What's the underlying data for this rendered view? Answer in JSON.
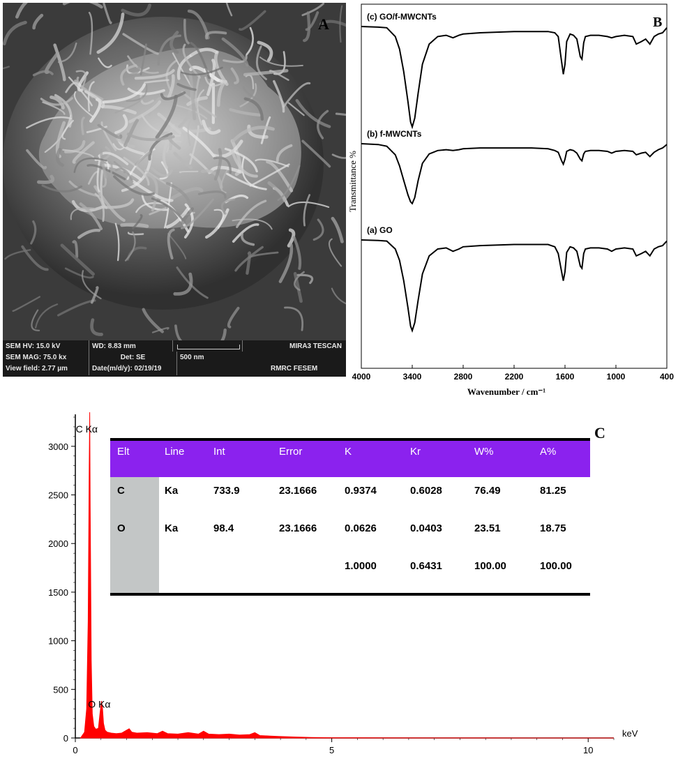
{
  "panel_a": {
    "letter": "A",
    "sem_info": {
      "hv": "SEM HV: 15.0 kV",
      "wd": "WD: 8.83 mm",
      "brand": "MIRA3 TESCAN",
      "mag": "SEM MAG: 75.0 kx",
      "det": "Det: SE",
      "scale": "500 nm",
      "view_field": "View field: 2.77 µm",
      "date": "Date(m/d/y): 02/19/19",
      "lab": "RMRC FESEM"
    }
  },
  "chart_data": [
    {
      "type": "line",
      "panel_letter": "B",
      "xlabel": "Wavenumber / cm⁻¹",
      "ylabel": "Transmittance %",
      "xlim": [
        4000,
        400
      ],
      "ticks": [
        "4000",
        "3400",
        "2800",
        "2200",
        "1600",
        "1000",
        "400"
      ],
      "tick_values": [
        4000,
        3400,
        2800,
        2200,
        1600,
        1000,
        400
      ],
      "grid": false,
      "series": [
        {
          "name": "(c) GO/f-MWCNTs",
          "x": [
            4000,
            3800,
            3700,
            3600,
            3550,
            3500,
            3450,
            3420,
            3400,
            3370,
            3330,
            3280,
            3200,
            3100,
            3000,
            2920,
            2850,
            2800,
            2600,
            2200,
            2000,
            1800,
            1720,
            1680,
            1640,
            1620,
            1600,
            1580,
            1540,
            1500,
            1460,
            1420,
            1400,
            1380,
            1360,
            1300,
            1200,
            1100,
            1050,
            1000,
            900,
            800,
            760,
            700,
            650,
            600,
            550,
            500,
            450,
            400
          ],
          "y": [
            98,
            97.5,
            97,
            90,
            80,
            62,
            38,
            22,
            18,
            25,
            45,
            68,
            84,
            90,
            91,
            89,
            91,
            92,
            93,
            94,
            94,
            94,
            93,
            90,
            70,
            60,
            68,
            86,
            92,
            91,
            88,
            74,
            72,
            85,
            90,
            91,
            91,
            90,
            89,
            90,
            91,
            90,
            84,
            86,
            88,
            84,
            90,
            92,
            93,
            97
          ],
          "label_offset": 0
        },
        {
          "name": "(b) f-MWCNTs",
          "x": [
            4000,
            3800,
            3700,
            3600,
            3550,
            3500,
            3450,
            3420,
            3400,
            3370,
            3330,
            3280,
            3200,
            3100,
            3000,
            2920,
            2850,
            2800,
            2600,
            2200,
            2000,
            1800,
            1720,
            1680,
            1640,
            1620,
            1600,
            1580,
            1540,
            1500,
            1460,
            1420,
            1400,
            1380,
            1360,
            1300,
            1200,
            1100,
            1050,
            1000,
            900,
            800,
            760,
            700,
            650,
            600,
            550,
            500,
            450,
            400
          ],
          "y": [
            98,
            97,
            95,
            85,
            72,
            55,
            38,
            30,
            28,
            35,
            55,
            75,
            86,
            90,
            91,
            90,
            91,
            92,
            93,
            93,
            93,
            92,
            90,
            88,
            78,
            74,
            80,
            89,
            91,
            90,
            87,
            80,
            78,
            86,
            89,
            90,
            90,
            89,
            87,
            89,
            90,
            89,
            85,
            87,
            88,
            83,
            88,
            91,
            93,
            97
          ],
          "label_offset": 1
        },
        {
          "name": "(a) GO",
          "x": [
            4000,
            3800,
            3700,
            3600,
            3550,
            3500,
            3450,
            3420,
            3400,
            3370,
            3330,
            3280,
            3200,
            3100,
            3000,
            2920,
            2850,
            2800,
            2600,
            2200,
            2000,
            1800,
            1720,
            1680,
            1640,
            1620,
            1600,
            1580,
            1540,
            1500,
            1460,
            1420,
            1400,
            1380,
            1360,
            1300,
            1200,
            1100,
            1050,
            1000,
            900,
            800,
            760,
            700,
            650,
            600,
            550,
            500,
            450,
            400
          ],
          "y": [
            98,
            97.5,
            97,
            90,
            80,
            62,
            38,
            22,
            18,
            25,
            45,
            68,
            84,
            90,
            91,
            88,
            90,
            92,
            93,
            94,
            94,
            94,
            92,
            86,
            70,
            62,
            70,
            87,
            92,
            91,
            88,
            75,
            73,
            86,
            90,
            91,
            91,
            90,
            88,
            90,
            91,
            90,
            84,
            86,
            88,
            84,
            90,
            92,
            93,
            97
          ],
          "label_offset": 2
        }
      ]
    },
    {
      "type": "line",
      "panel_letter": "C",
      "xlabel": "keV",
      "ylabel": "",
      "xlim": [
        0,
        10.5
      ],
      "ylim": [
        0,
        3300
      ],
      "x_ticks": [
        0,
        5,
        10
      ],
      "y_ticks": [
        0,
        500,
        1000,
        1500,
        2000,
        2500,
        3000
      ],
      "peak_labels": [
        {
          "text": "C Kα",
          "x": 0.28,
          "y": 3300
        },
        {
          "text": "O Kα",
          "x": 0.52,
          "y": 470
        }
      ],
      "series": [
        {
          "color": "#ff0000",
          "x": [
            0.1,
            0.18,
            0.22,
            0.25,
            0.27,
            0.28,
            0.29,
            0.31,
            0.33,
            0.36,
            0.4,
            0.45,
            0.48,
            0.51,
            0.53,
            0.55,
            0.58,
            0.62,
            0.7,
            0.8,
            0.9,
            1.0,
            1.05,
            1.1,
            1.2,
            1.4,
            1.6,
            1.7,
            1.8,
            2.0,
            2.2,
            2.4,
            2.5,
            2.6,
            2.8,
            3.0,
            3.2,
            3.4,
            3.5,
            3.6,
            3.8,
            4.0,
            4.3,
            4.6,
            5.0,
            6.0,
            7.0,
            8.0,
            9.0,
            10.0,
            10.5
          ],
          "y": [
            0,
            60,
            300,
            1200,
            2800,
            3350,
            2400,
            800,
            250,
            120,
            90,
            100,
            250,
            380,
            300,
            150,
            80,
            60,
            50,
            45,
            50,
            80,
            95,
            60,
            50,
            55,
            45,
            70,
            45,
            40,
            55,
            40,
            70,
            40,
            35,
            40,
            30,
            35,
            55,
            25,
            20,
            15,
            10,
            5,
            3,
            2,
            1,
            1,
            0,
            0,
            0
          ]
        }
      ],
      "table": {
        "headers": [
          "Elt",
          "Line",
          "Int",
          "Error",
          "K",
          "Kr",
          "W%",
          "A%"
        ],
        "rows": [
          [
            "C",
            "Ka",
            "733.9",
            "23.1666",
            "0.9374",
            "0.6028",
            "76.49",
            "81.25"
          ],
          [
            "O",
            "Ka",
            "98.4",
            "23.1666",
            "0.0626",
            "0.0403",
            "23.51",
            "18.75"
          ],
          [
            "",
            "",
            "",
            "",
            "1.0000",
            "0.6431",
            "100.00",
            "100.00"
          ]
        ],
        "header_color": "#8b22ee",
        "stub_color": "#c3c6c6"
      }
    }
  ]
}
